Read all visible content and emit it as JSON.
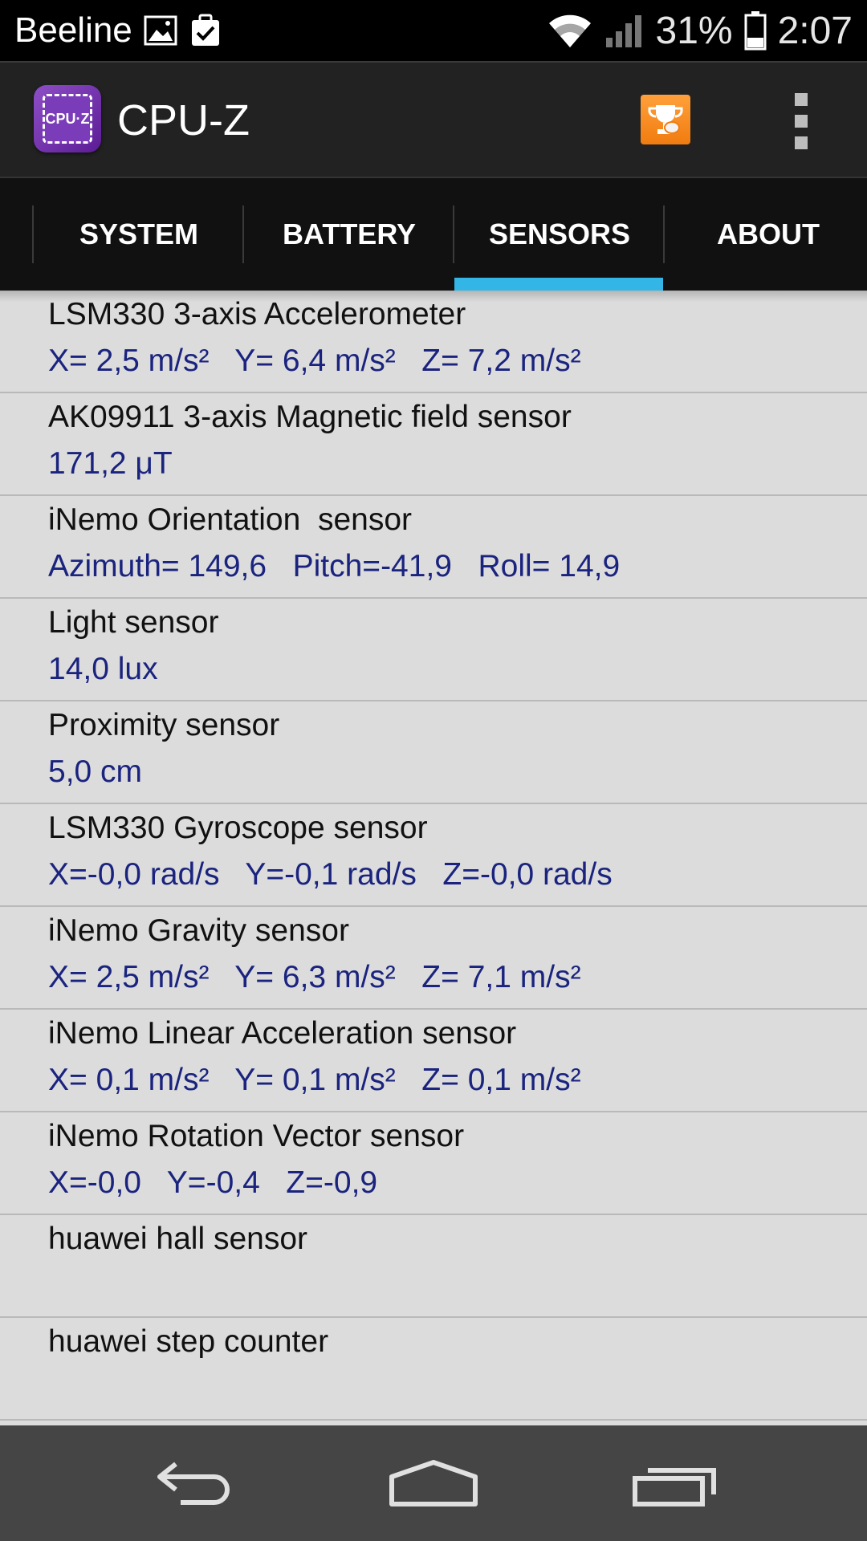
{
  "status_bar": {
    "carrier": "Beeline",
    "battery_percent": "31%",
    "time": "2:07",
    "icons": [
      "image-icon",
      "clipboard-check-icon",
      "wifi-icon",
      "cell-signal-icon",
      "battery-icon"
    ]
  },
  "app": {
    "title": "CPU-Z",
    "icon_label": "CPU·Z"
  },
  "tabs": [
    {
      "label": "SYSTEM",
      "selected": false
    },
    {
      "label": "BATTERY",
      "selected": false
    },
    {
      "label": "SENSORS",
      "selected": true
    },
    {
      "label": "ABOUT",
      "selected": false
    }
  ],
  "colors": {
    "tab_indicator": "#33b5e5",
    "value_text": "#1a237e",
    "trophy_button": "#f58b1f"
  },
  "sensors": [
    {
      "name": "LSM330 3-axis Accelerometer",
      "value": "X= 2,5 m/s²   Y= 6,4 m/s²   Z= 7,2 m/s²"
    },
    {
      "name": "AK09911 3-axis Magnetic field sensor",
      "value": "171,2 μT"
    },
    {
      "name": "iNemo Orientation  sensor",
      "value": "Azimuth= 149,6   Pitch=-41,9   Roll= 14,9"
    },
    {
      "name": "Light sensor",
      "value": "14,0 lux"
    },
    {
      "name": "Proximity sensor",
      "value": "5,0 cm"
    },
    {
      "name": "LSM330 Gyroscope sensor",
      "value": "X=-0,0 rad/s   Y=-0,1 rad/s   Z=-0,0 rad/s"
    },
    {
      "name": "iNemo Gravity sensor",
      "value": "X= 2,5 m/s²   Y= 6,3 m/s²   Z= 7,1 m/s²"
    },
    {
      "name": "iNemo Linear Acceleration sensor",
      "value": "X= 0,1 m/s²   Y= 0,1 m/s²   Z= 0,1 m/s²"
    },
    {
      "name": "iNemo Rotation Vector sensor",
      "value": "X=-0,0   Y=-0,4   Z=-0,9"
    },
    {
      "name": "huawei hall sensor",
      "value": ""
    },
    {
      "name": "huawei step counter",
      "value": ""
    }
  ],
  "nav_bar": {
    "buttons": [
      "back-icon",
      "home-icon",
      "recent-apps-icon"
    ]
  }
}
